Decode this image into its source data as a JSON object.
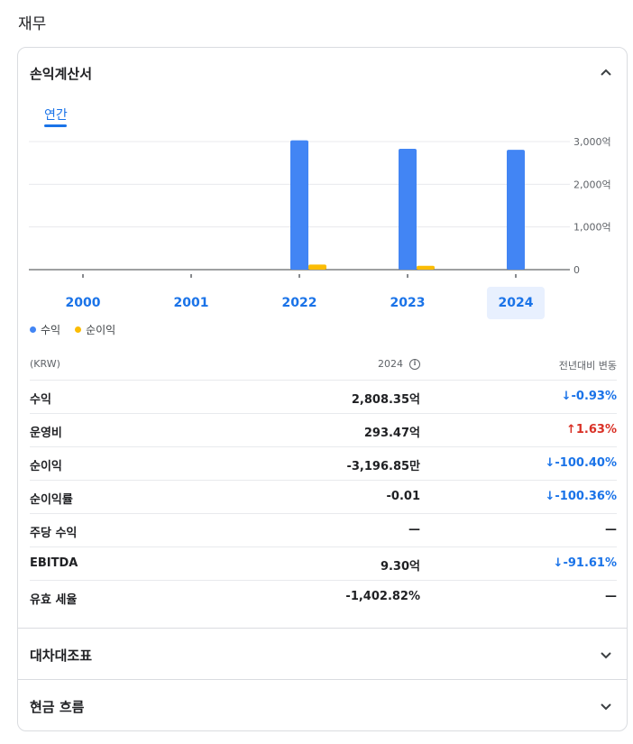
{
  "section_title": "재무",
  "income": {
    "title": "손익계산서",
    "tab": "연간",
    "chart_data": {
      "type": "bar",
      "categories": [
        "2000",
        "2001",
        "2022",
        "2023",
        "2024"
      ],
      "selected_category": "2024",
      "y_ticks": [
        "3,000억",
        "2,000억",
        "1,000억",
        "0"
      ],
      "ylim": [
        0,
        3000
      ],
      "series": [
        {
          "name": "수익",
          "color": "#4285f4",
          "values": [
            0,
            0,
            3030,
            2830,
            2808.35
          ]
        },
        {
          "name": "순이익",
          "color": "#fbbc04",
          "values": [
            0,
            0,
            120,
            90,
            0
          ]
        }
      ],
      "legend_position": "bottom-left"
    },
    "table": {
      "headers": [
        "(KRW)",
        "2024",
        "전년대비 변동"
      ],
      "rows": [
        {
          "label": "수익",
          "value": "2,808.35억",
          "change": "-0.93%",
          "trend": "down"
        },
        {
          "label": "운영비",
          "value": "293.47억",
          "change": "1.63%",
          "trend": "up"
        },
        {
          "label": "순이익",
          "value": "-3,196.85만",
          "change": "-100.40%",
          "trend": "down"
        },
        {
          "label": "순이익률",
          "value": "-0.01",
          "change": "-100.36%",
          "trend": "down"
        },
        {
          "label": "주당 수익",
          "value": "—",
          "change": "—",
          "trend": "flat"
        },
        {
          "label": "EBITDA",
          "value": "9.30억",
          "change": "-91.61%",
          "trend": "down"
        },
        {
          "label": "유효 세율",
          "value": "-1,402.82%",
          "change": "—",
          "trend": "flat"
        }
      ]
    }
  },
  "balance_sheet": {
    "title": "대차대조표"
  },
  "cash_flow": {
    "title": "현금 흐름"
  },
  "icons": {
    "expanded": "chevron-up-icon",
    "collapsed": "chevron-down-icon",
    "info": "info-icon"
  }
}
